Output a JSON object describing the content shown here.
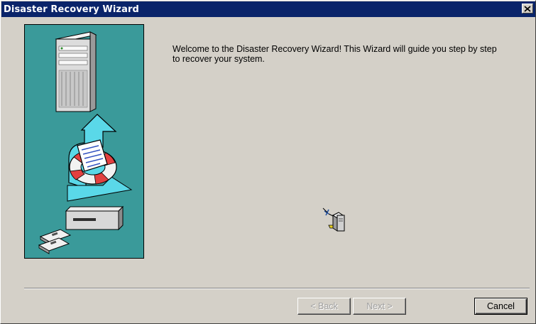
{
  "window": {
    "title": "Disaster Recovery Wizard",
    "close_glyph": "×"
  },
  "main": {
    "welcome_text": "Welcome to the Disaster Recovery Wizard! This Wizard will guide you step by step to recover your system."
  },
  "buttons": {
    "back": "< Back",
    "next": "Next >",
    "cancel": "Cancel"
  },
  "icons": {
    "side_illustration": "server-recovery-illustration",
    "center": "computer-network-icon"
  },
  "colors": {
    "titlebar": "#0a246a",
    "dialog_bg": "#d4d0c8",
    "panel_teal": "#3a9a9a",
    "arrow_cyan": "#5ad8e8"
  }
}
